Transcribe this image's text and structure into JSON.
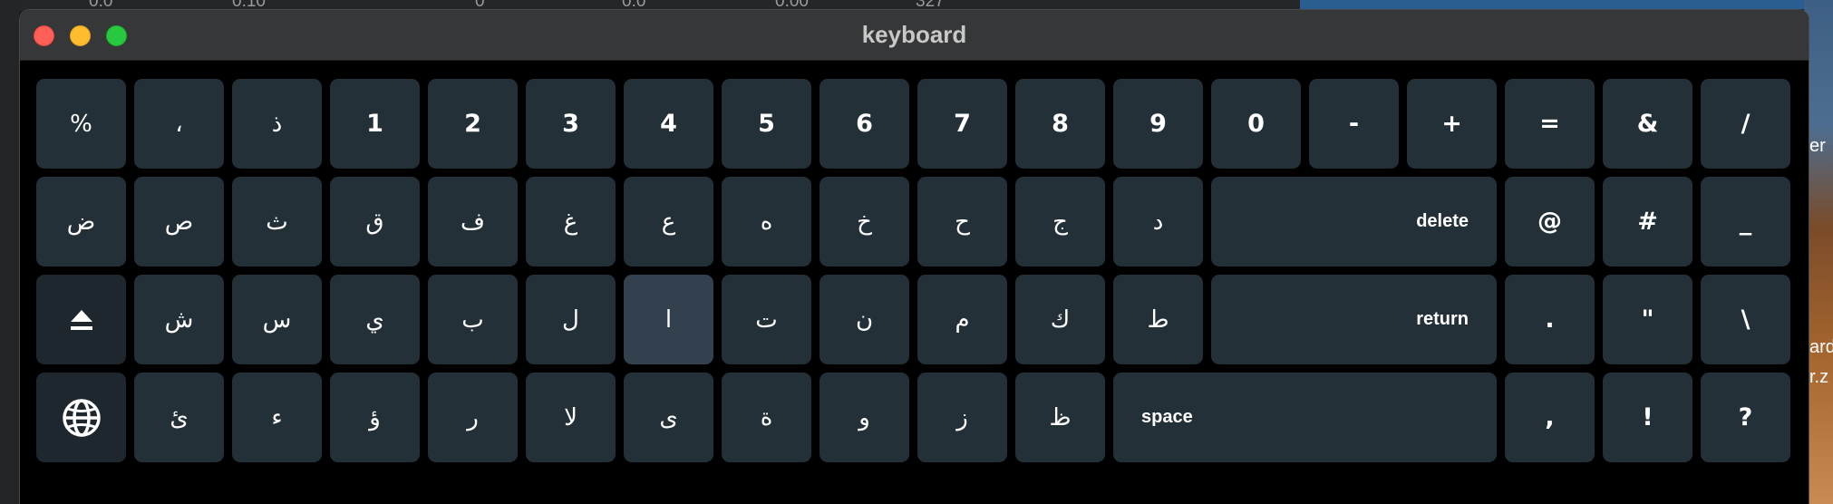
{
  "window": {
    "title": "keyboard"
  },
  "background": {
    "numbers": [
      "0.0",
      "0.10",
      "0",
      "0.0",
      "0.00",
      "327"
    ],
    "right_text": [
      "er",
      "ard",
      "r.z"
    ]
  },
  "keyboard": {
    "row1": [
      "%",
      "،",
      "ذ",
      "1",
      "2",
      "3",
      "4",
      "5",
      "6",
      "7",
      "8",
      "9",
      "0",
      "-",
      "+",
      "=",
      "&",
      "/"
    ],
    "row2": [
      "ض",
      "ص",
      "ث",
      "ق",
      "ف",
      "غ",
      "ع",
      "ه",
      "خ",
      "ح",
      "ج",
      "د",
      "delete",
      "@",
      "#",
      "_"
    ],
    "row3": [
      "shift-icon",
      "ش",
      "س",
      "ي",
      "ب",
      "ل",
      "ا",
      "ت",
      "ن",
      "م",
      "ك",
      "ط",
      "return",
      ".",
      "\"",
      "\\"
    ],
    "row4": [
      "globe-icon",
      "ئ",
      "ء",
      "ؤ",
      "ر",
      "لا",
      "ى",
      "ة",
      "و",
      "ز",
      "ظ",
      "space",
      ",",
      "!",
      "?"
    ],
    "active_key": "ا"
  },
  "colors": {
    "key": "#243038",
    "key_function": "#1e272e",
    "key_active": "#33414f",
    "close": "#fe5f57",
    "minimize": "#febc2e",
    "maximize": "#28c840"
  }
}
